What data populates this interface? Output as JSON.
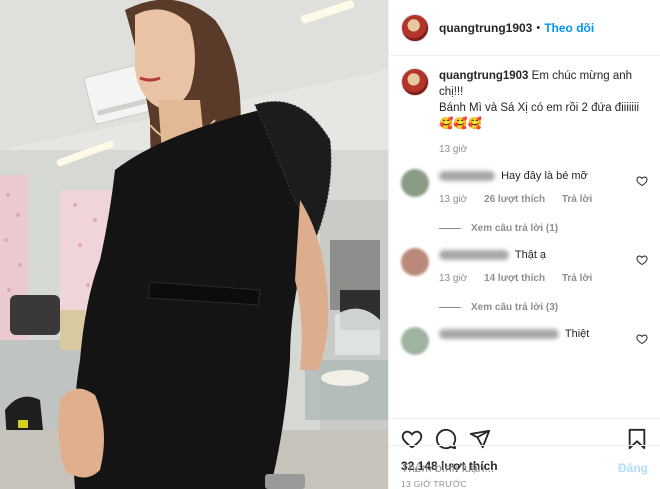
{
  "header": {
    "username": "quangtrung1903",
    "separator": "•",
    "follow_label": "Theo dõi"
  },
  "caption": {
    "username": "quangtrung1903",
    "text": "Em chúc mừng anh chị!!!",
    "line2": "Bánh Mì và Sá Xị có em rồi 2 đứa điiiiiii",
    "emojis": "🥰🥰🥰",
    "time": "13 giờ"
  },
  "comments": [
    {
      "text": "Hay đây là bé mỡ",
      "time": "13 giờ",
      "likes": "26 lượt thích",
      "reply_label": "Trả lời",
      "view_replies": "Xem câu trả lời (1)",
      "avatar_color": "#8a9b86"
    },
    {
      "text": "Thật ạ",
      "time": "13 giờ",
      "likes": "14 lượt thích",
      "reply_label": "Trả lời",
      "view_replies": "Xem câu trả lời (3)",
      "avatar_color": "#b98a7a"
    },
    {
      "text": "Thiệt",
      "avatar_color": "#9fb4a0"
    }
  ],
  "actions": {
    "like_icon": "heart-icon",
    "comment_icon": "comment-icon",
    "share_icon": "share-icon",
    "save_icon": "bookmark-icon"
  },
  "likes_count": "32,148 lượt thích",
  "posted_ago": "13 GIỜ TRƯỚC",
  "add_comment": {
    "placeholder": "Thêm bình luận...",
    "post_label": "Đăng"
  },
  "colors": {
    "accent": "#0095f6",
    "post_disabled": "#b2dffc",
    "muted": "#8e8e8e"
  }
}
